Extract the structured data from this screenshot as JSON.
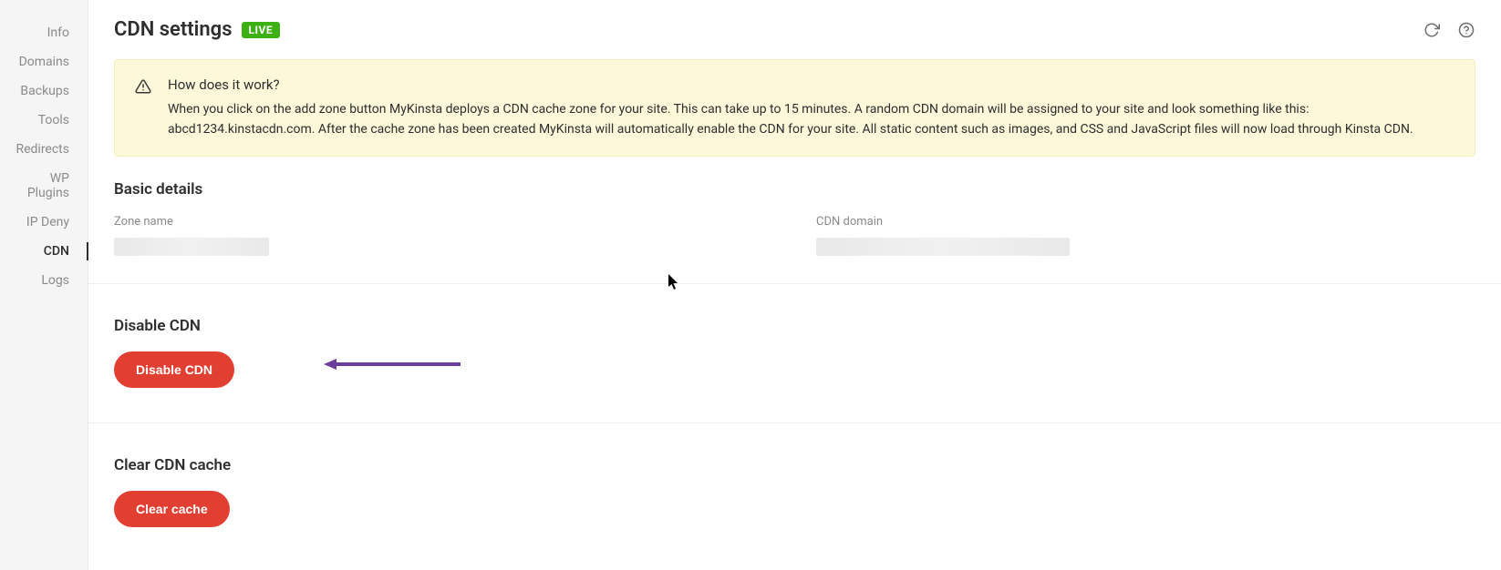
{
  "sidebar": {
    "items": [
      {
        "label": "Info"
      },
      {
        "label": "Domains"
      },
      {
        "label": "Backups"
      },
      {
        "label": "Tools"
      },
      {
        "label": "Redirects"
      },
      {
        "label": "WP Plugins"
      },
      {
        "label": "IP Deny"
      },
      {
        "label": "CDN"
      },
      {
        "label": "Logs"
      }
    ],
    "active_index": 7
  },
  "header": {
    "title": "CDN settings",
    "badge": "LIVE"
  },
  "banner": {
    "title": "How does it work?",
    "body": "When you click on the add zone button MyKinsta deploys a CDN cache zone for your site. This can take up to 15 minutes. A random CDN domain will be assigned to your site and look something like this: abcd1234.kinstacdn.com. After the cache zone has been created MyKinsta will automatically enable the CDN for your site. All static content such as images, and CSS and JavaScript files will now load through Kinsta CDN."
  },
  "basic_details": {
    "heading": "Basic details",
    "zone_label": "Zone name",
    "cdn_label": "CDN domain"
  },
  "disable_section": {
    "heading": "Disable CDN",
    "button": "Disable CDN"
  },
  "clear_section": {
    "heading": "Clear CDN cache",
    "button": "Clear cache"
  },
  "annotation": {
    "arrow_color": "#6a3e9c"
  }
}
